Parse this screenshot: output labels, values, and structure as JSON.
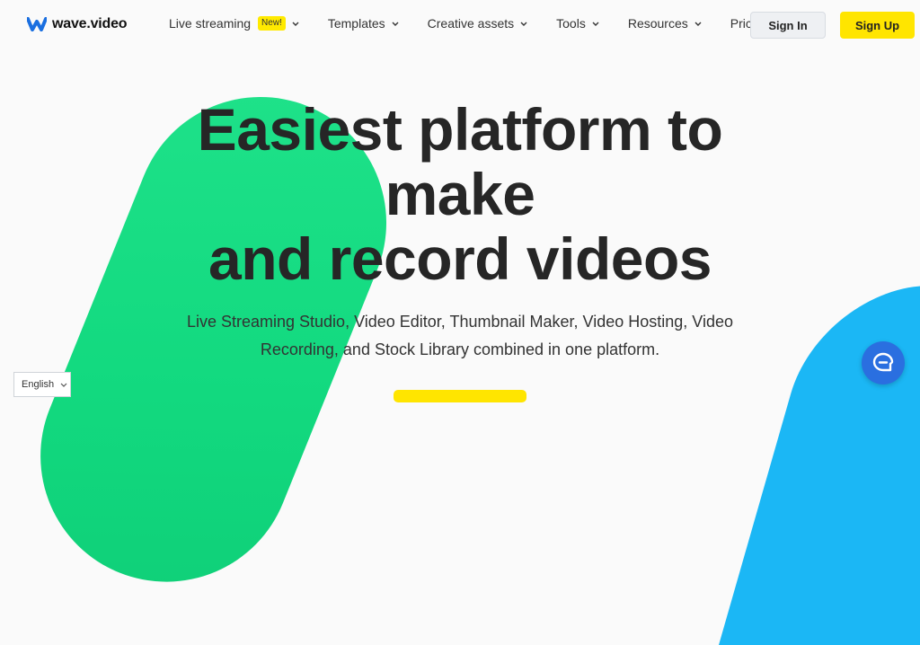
{
  "brand": {
    "name": "wave.video",
    "color": "#1a6fe0"
  },
  "nav": {
    "items": [
      {
        "label": "Live streaming",
        "badge": "New!",
        "has_dropdown": true
      },
      {
        "label": "Templates",
        "has_dropdown": true
      },
      {
        "label": "Creative assets",
        "has_dropdown": true
      },
      {
        "label": "Tools",
        "has_dropdown": true
      },
      {
        "label": "Resources",
        "has_dropdown": true
      },
      {
        "label": "Pricing",
        "has_dropdown": false
      }
    ],
    "sign_in": "Sign In",
    "sign_up": "Sign Up"
  },
  "hero": {
    "title_line1": "Easiest platform to",
    "title_line2": "make",
    "title_line3": "and record videos",
    "subtitle": "Live Streaming Studio, Video Editor, Thumbnail Maker, Video Hosting, Video Recording, and Stock Library combined in one platform."
  },
  "language_select": {
    "value": "English"
  },
  "chat": {
    "icon": "chat-bubble-icon"
  },
  "colors": {
    "accent_yellow": "#ffe500",
    "green_shape": "#12d97f",
    "blue_shape": "#1bb7f5",
    "chat_button": "#2a6fe0"
  }
}
